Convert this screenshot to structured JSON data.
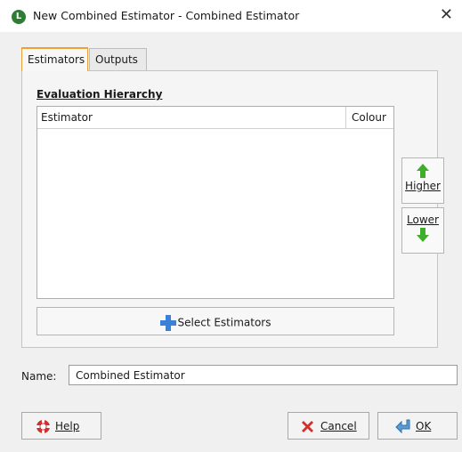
{
  "window": {
    "title": "New Combined Estimator - Combined Estimator",
    "close_glyph": "✕",
    "app_icon": "leapfrog-icon"
  },
  "tabs": [
    {
      "label": "Estimators",
      "active": true
    },
    {
      "label": "Outputs",
      "active": false
    }
  ],
  "hierarchy": {
    "section_label": "Evaluation Hierarchy",
    "columns": {
      "estimator": "Estimator",
      "colour": "Colour"
    },
    "rows": []
  },
  "side_buttons": {
    "higher_label": "Higher",
    "lower_label": "Lower"
  },
  "select_button": {
    "label": "Select Estimators",
    "icon": "plus-icon"
  },
  "name_field": {
    "label": "Name:",
    "value": "Combined Estimator"
  },
  "footer": {
    "help_label": "Help",
    "cancel_label": "Cancel",
    "ok_label": "OK"
  },
  "colors": {
    "tab_accent": "#f0a030",
    "arrow_green": "#3fae2a",
    "plus_blue": "#3b82d6",
    "cancel_red": "#d32f2f"
  }
}
